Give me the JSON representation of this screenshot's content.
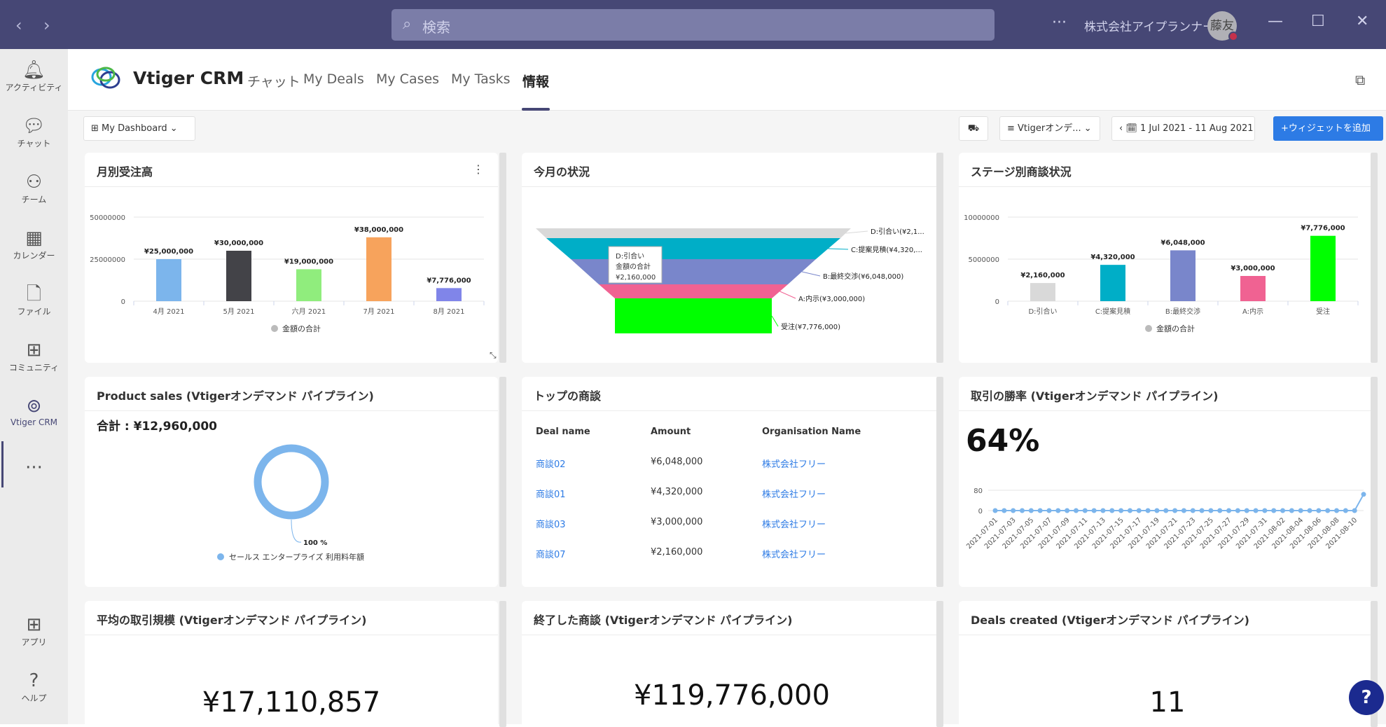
{
  "titlebar": {
    "back": "‹",
    "forward": "›",
    "search_placeholder": "検索",
    "more": "···",
    "org": "株式会社アイプランナー",
    "avatar": "藤友",
    "minimize": "—",
    "maximize": "☐",
    "close": "✕"
  },
  "rail": [
    {
      "label": "アクティビティ",
      "icon": "bell-icon",
      "glyph": "🔔︎"
    },
    {
      "label": "チャット",
      "icon": "chat-icon",
      "glyph": "💬︎"
    },
    {
      "label": "チーム",
      "icon": "team-icon",
      "glyph": "⚇"
    },
    {
      "label": "カレンダー",
      "icon": "calendar-icon",
      "glyph": "▦"
    },
    {
      "label": "ファイル",
      "icon": "file-icon",
      "glyph": "🗋"
    },
    {
      "label": "コミュニティ",
      "icon": "community-icon",
      "glyph": "⊞"
    },
    {
      "label": "Vtiger CRM",
      "icon": "vtiger-icon",
      "glyph": "⊚"
    },
    {
      "label": "",
      "icon": "more-icon",
      "glyph": "···"
    },
    {
      "label": "アプリ",
      "icon": "apps-icon",
      "glyph": "⊞"
    },
    {
      "label": "ヘルプ",
      "icon": "help-icon",
      "glyph": "?"
    }
  ],
  "app": {
    "name": "Vtiger CRM",
    "tabs": [
      "チャット",
      "My Deals",
      "My Cases",
      "My Tasks",
      "情報"
    ],
    "active_tab": "情報"
  },
  "toolbar": {
    "dashboard": "⊞  My Dashboard  ⌄",
    "filter_icon": "⛟",
    "pipeline": "≡ Vtigerオンデ...  ⌄",
    "date_range": "‹  🗓  1 Jul 2021 - 11 Aug 2021  ›",
    "add_widget": "+ウィジェットを追加"
  },
  "widgets": {
    "monthly": {
      "title": "月別受注高",
      "kebab": "⋮",
      "legend": "金額の合計"
    },
    "funnel": {
      "title": "今月の状況",
      "tooltip": [
        "D:引合い",
        "金額の合計",
        "¥2,160,000"
      ]
    },
    "stage": {
      "title": "ステージ別商談状況",
      "legend": "金額の合計"
    },
    "product": {
      "title": "Product sales (Vtigerオンデマンド パイプライン)",
      "total": "合計 : ¥12,960,000",
      "pct": "100 %",
      "legend": "セールス エンタープライズ 利用料年額"
    },
    "top": {
      "title": "トップの商談",
      "headers": [
        "Deal name",
        "Amount",
        "Organisation Name"
      ],
      "rows": [
        [
          "商談02",
          "¥6,048,000",
          "株式会社フリー"
        ],
        [
          "商談01",
          "¥4,320,000",
          "株式会社フリー"
        ],
        [
          "商談03",
          "¥3,000,000",
          "株式会社フリー"
        ],
        [
          "商談07",
          "¥2,160,000",
          "株式会社フリー"
        ]
      ]
    },
    "winrate": {
      "title": "取引の勝率 (Vtigerオンデマンド パイプライン)",
      "value": "64%"
    },
    "avg": {
      "title": "平均の取引規模 (Vtigerオンデマンド パイプライン)",
      "value": "¥17,110,857"
    },
    "closed": {
      "title": "終了した商談 (Vtigerオンデマンド パイプライン)",
      "value": "¥119,776,000"
    },
    "created": {
      "title": "Deals created (Vtigerオンデマンド パイプライン)",
      "value": "11"
    }
  },
  "help_button": "?",
  "chart_data": [
    {
      "type": "bar",
      "title": "月別受注高",
      "categories": [
        "4月 2021",
        "5月 2021",
        "六月 2021",
        "7月 2021",
        "8月 2021"
      ],
      "values": [
        25000000,
        30000000,
        19000000,
        38000000,
        7776000
      ],
      "labels": [
        "¥25,000,000",
        "¥30,000,000",
        "¥19,000,000",
        "¥38,000,000",
        "¥7,776,000"
      ],
      "colors": [
        "#7cb5ec",
        "#434348",
        "#90ed7d",
        "#f7a35c",
        "#8085e9"
      ],
      "yticks": [
        0,
        25000000,
        50000000
      ],
      "ylim": [
        0,
        55000000
      ],
      "legend": "金額の合計"
    },
    {
      "type": "funnel",
      "title": "今月の状況",
      "categories": [
        "D:引合い(¥2,1...",
        "C:提案見積(¥4,320,...",
        "B:最終交渉(¥6,048,000)",
        "A:内示(¥3,000,000)",
        "受注(¥7,776,000)"
      ],
      "values": [
        2160000,
        4320000,
        6048000,
        3000000,
        7776000
      ],
      "colors": [
        "#d9d9d9",
        "#00aec7",
        "#7986cb",
        "#f06292",
        "#00ff00"
      ]
    },
    {
      "type": "bar",
      "title": "ステージ別商談状況",
      "categories": [
        "D:引合い",
        "C:提案見積",
        "B:最終交渉",
        "A:内示",
        "受注"
      ],
      "values": [
        2160000,
        4320000,
        6048000,
        3000000,
        7776000
      ],
      "labels": [
        "¥2,160,000",
        "¥4,320,000",
        "¥6,048,000",
        "¥3,000,000",
        "¥7,776,000"
      ],
      "colors": [
        "#d9d9d9",
        "#00aec7",
        "#7986cb",
        "#f06292",
        "#00ff00"
      ],
      "yticks": [
        0,
        5000000,
        10000000
      ],
      "ylim": [
        0,
        11000000
      ],
      "legend": "金額の合計"
    },
    {
      "type": "pie",
      "title": "Product sales (Vtigerオンデマンド パイプライン)",
      "categories": [
        "セールス エンタープライズ 利用料年額"
      ],
      "values": [
        100
      ],
      "colors": [
        "#7cb5ec"
      ]
    },
    {
      "type": "line",
      "title": "取引の勝率 (Vtigerオンデマンド パイプライン)",
      "x": [
        "2021-07-01",
        "2021-07-02",
        "2021-07-03",
        "2021-07-04",
        "2021-07-05",
        "2021-07-06",
        "2021-07-07",
        "2021-07-08",
        "2021-07-09",
        "2021-07-10",
        "2021-07-11",
        "2021-07-12",
        "2021-07-13",
        "2021-07-14",
        "2021-07-15",
        "2021-07-16",
        "2021-07-17",
        "2021-07-18",
        "2021-07-19",
        "2021-07-20",
        "2021-07-21",
        "2021-07-22",
        "2021-07-23",
        "2021-07-24",
        "2021-07-25",
        "2021-07-26",
        "2021-07-27",
        "2021-07-28",
        "2021-07-29",
        "2021-07-30",
        "2021-07-31",
        "2021-08-01",
        "2021-08-02",
        "2021-08-03",
        "2021-08-04",
        "2021-08-05",
        "2021-08-06",
        "2021-08-07",
        "2021-08-08",
        "2021-08-09",
        "2021-08-10",
        "2021-08-11"
      ],
      "tick_labels": [
        "2021-07-01",
        "2021-07-03",
        "2021-07-05",
        "2021-07-07",
        "2021-07-09",
        "2021-07-11",
        "2021-07-13",
        "2021-07-15",
        "2021-07-17",
        "2021-07-19",
        "2021-07-21",
        "2021-07-23",
        "2021-07-25",
        "2021-07-27",
        "2021-07-29",
        "2021-07-31",
        "2021-08-02",
        "2021-08-04",
        "2021-08-06",
        "2021-08-08",
        "2021-08-10"
      ],
      "values": [
        0,
        0,
        0,
        0,
        0,
        0,
        0,
        0,
        0,
        0,
        0,
        0,
        0,
        0,
        0,
        0,
        0,
        0,
        0,
        0,
        0,
        0,
        0,
        0,
        0,
        0,
        0,
        0,
        0,
        0,
        0,
        0,
        0,
        0,
        0,
        0,
        0,
        0,
        0,
        0,
        0,
        64
      ],
      "yticks": [
        0,
        80
      ],
      "ylim": [
        0,
        80
      ],
      "color": "#7cb5ec"
    }
  ]
}
